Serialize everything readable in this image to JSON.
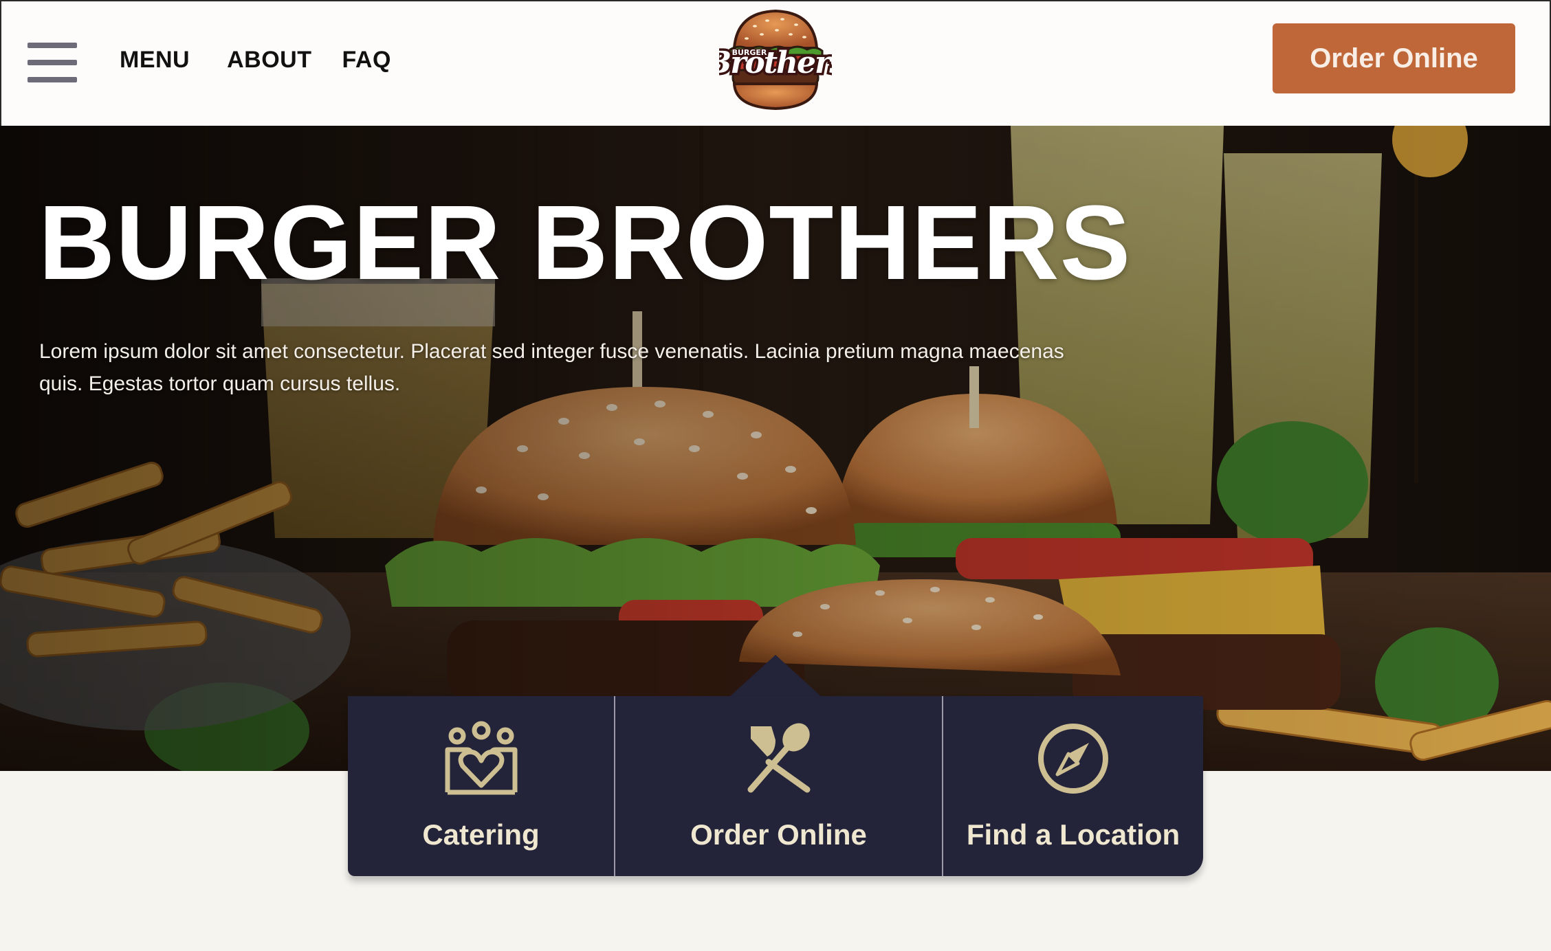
{
  "header": {
    "nav": [
      {
        "label": "MENU"
      },
      {
        "label": "ABOUT"
      },
      {
        "label": "FAQ"
      }
    ],
    "logo": {
      "text_top": "BURGER",
      "text_main": "Brothers"
    },
    "order_button": "Order Online"
  },
  "hero": {
    "title": "BURGER BROTHERS",
    "description": "Lorem ipsum dolor sit amet consectetur. Placerat sed integer fusce venenatis. Lacinia pretium magna maecenas quis. Egestas tortor quam cursus tellus."
  },
  "quick_actions": [
    {
      "label": "Catering",
      "icon": "catering-people-heart-icon"
    },
    {
      "label": "Order Online",
      "icon": "fork-spoon-icon"
    },
    {
      "label": "Find a Location",
      "icon": "compass-icon"
    }
  ],
  "colors": {
    "accent": "#c0673a",
    "panel": "#23233a",
    "panel_text": "#efe7cf",
    "icon": "#cdbf92",
    "page_bg": "#f6f4ef"
  }
}
